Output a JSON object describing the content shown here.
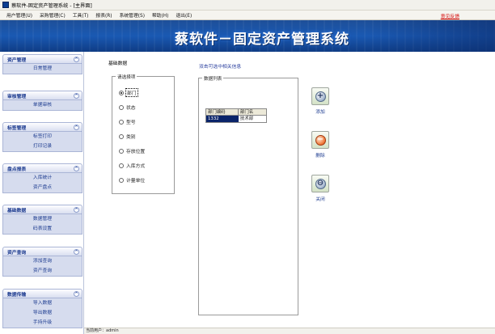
{
  "window": {
    "title": "蔡软件-固定资产管理系统 - [主界面]"
  },
  "menu": {
    "items": [
      "用户管理(U)",
      "采购管理(C)",
      "工具(T)",
      "报表(R)",
      "系统管理(S)",
      "帮助(H)",
      "退出(E)"
    ],
    "right_link": "意见反馈"
  },
  "banner": {
    "title": "蔡软件－固定资产管理系统"
  },
  "sidebar": {
    "groups": [
      {
        "title": "资产管理",
        "links": [
          "日常管理"
        ]
      },
      {
        "title": "审核管理",
        "links": [
          "单据审核"
        ]
      },
      {
        "title": "标签管理",
        "links": [
          "标签打印",
          "打印记录"
        ]
      },
      {
        "title": "盘点报表",
        "links": [
          "入库统计",
          "资产盘点"
        ]
      },
      {
        "title": "基础数据",
        "links": [
          "数据管理",
          "码表设置"
        ]
      },
      {
        "title": "资产查询",
        "links": [
          "添加查询",
          "资产查询"
        ]
      },
      {
        "title": "数据传输",
        "links": [
          "导入数据",
          "导出数据",
          "手持升级"
        ]
      }
    ],
    "toggle_glyph": "^"
  },
  "main": {
    "section_title": "基础数据",
    "hint": "双击可选中相关信息",
    "select_group": {
      "legend": "请选择项",
      "options": [
        "部门",
        "状态",
        "型号",
        "类别",
        "存放位置",
        "入库方式",
        "计量单位"
      ],
      "selected_index": 0
    },
    "list_group": {
      "legend": "数据列表",
      "columns": [
        "部门编码",
        "部门名"
      ],
      "rows": [
        [
          "1332",
          "技术部"
        ]
      ]
    },
    "actions": [
      {
        "label": "添加",
        "icon": "plus-icon",
        "glyph": "+"
      },
      {
        "label": "删除",
        "icon": "minus-icon",
        "glyph": "−"
      },
      {
        "label": "关闭",
        "icon": "close-icon",
        "glyph": "⊖"
      }
    ]
  },
  "status": {
    "text": "当前用户：admin"
  },
  "colors": {
    "banner": "#1a59b3",
    "accent": "#1b3a8f",
    "link_red": "#d40000",
    "selection": "#0a246a"
  }
}
